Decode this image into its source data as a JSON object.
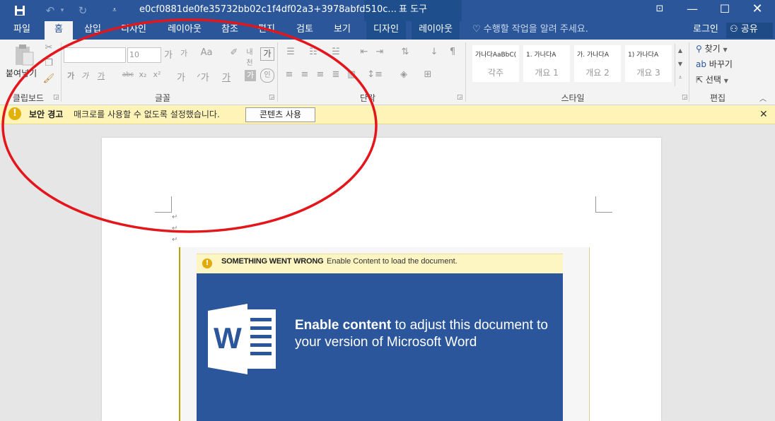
{
  "titlebar": {
    "doc_title": "e0cf0881de0fe35732bb02c1f4df02a3+3978abfd510c...",
    "context_tab_title": "표 도구",
    "save_icon": "save-icon",
    "undo_icon": "undo-icon",
    "redo_icon": "redo-icon"
  },
  "tabs": [
    "파일",
    "홈",
    "삽입",
    "디자인",
    "레이아웃",
    "참조",
    "편지",
    "검토",
    "보기",
    "디자인",
    "레이아웃"
  ],
  "active_tab": "홈",
  "tell_me": "수행할 작업을 알려 주세요.",
  "login": "로그인",
  "share": "공유",
  "ribbon": {
    "clipboard": {
      "paste": "붙여넣기",
      "label": "클립보드"
    },
    "font": {
      "size": "10",
      "label": "글꼴",
      "b": "가",
      "i": "가",
      "u": "가",
      "strike": "abc",
      "sub": "x₂",
      "sup": "x²"
    },
    "paragraph": {
      "label": "단락"
    },
    "styles": {
      "label": "스타일",
      "items": [
        {
          "sample": "가나다AaBbC(",
          "name": "각주"
        },
        {
          "sample": "1.   가나다A",
          "name": "개요 1"
        },
        {
          "sample": "가.   가나다A",
          "name": "개요 2"
        },
        {
          "sample": "1)   가나다A",
          "name": "개요 3"
        }
      ]
    },
    "editing": {
      "label": "편집",
      "find": "찾기",
      "replace": "바꾸기",
      "select": "선택"
    }
  },
  "security_bar": {
    "title": "보안 경고",
    "message": "매크로를 사용할 수 없도록 설정했습니다.",
    "button": "콘텐츠 사용"
  },
  "embedded_lure": {
    "bar_title": "SOMETHING WENT WRONG",
    "bar_message": "Enable Content to load the document.",
    "headline_bold": "Enable content",
    "headline_rest": " to adjust this document to your version of Microsoft Word",
    "logo_letter": "W"
  },
  "colors": {
    "titlebar_bg": "#2b579a",
    "ribbon_bg": "#f3f3f3",
    "security_bar_bg": "#fff4b8",
    "annotation_red": "#e3161c",
    "lure_blue": "#2b569b"
  }
}
